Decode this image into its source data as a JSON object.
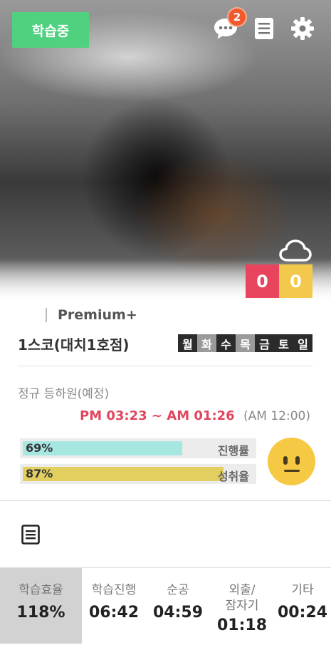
{
  "header": {
    "status_label": "학습중",
    "message_badge_count": "2",
    "icons": [
      "chat-icon",
      "document-icon",
      "gear-icon"
    ]
  },
  "hero": {
    "weather_icon": "cloud-icon",
    "scores": [
      "0",
      "0"
    ]
  },
  "profile": {
    "membership": "Premium+",
    "branch": "1스코(대치1호점)",
    "days": [
      {
        "label": "월",
        "active": true
      },
      {
        "label": "화",
        "active": false
      },
      {
        "label": "수",
        "active": true
      },
      {
        "label": "목",
        "active": false
      },
      {
        "label": "금",
        "active": true
      },
      {
        "label": "토",
        "active": true
      },
      {
        "label": "일",
        "active": true
      }
    ]
  },
  "schedule": {
    "label": "정규 등하원(예정)",
    "time_range": "PM 03:23 ~ AM 01:26",
    "sub_time": "(AM 12:00)"
  },
  "progress": {
    "progress_pct": "69%",
    "progress_value": 0.69,
    "progress_label": "진행률",
    "achievement_pct": "87%",
    "achievement_value": 0.87,
    "achievement_label": "성취율"
  },
  "mood_icon": "neutral-face-icon",
  "stats": [
    {
      "label": "학습효율",
      "value": "118%"
    },
    {
      "label": "학습진행",
      "value": "06:42"
    },
    {
      "label": "순공",
      "value": "04:59"
    },
    {
      "label": "외출/\n잠자기",
      "value": "01:18"
    },
    {
      "label": "기타",
      "value": "00:24"
    }
  ],
  "colors": {
    "status_green": "#4fd17f",
    "badge_orange": "#f05a2c",
    "score_red": "#e8445d",
    "score_yellow": "#f2c94c",
    "time_red": "#e0465e",
    "progress_teal": "#a7e7e2",
    "achievement_yellow": "#e3cf5f"
  }
}
